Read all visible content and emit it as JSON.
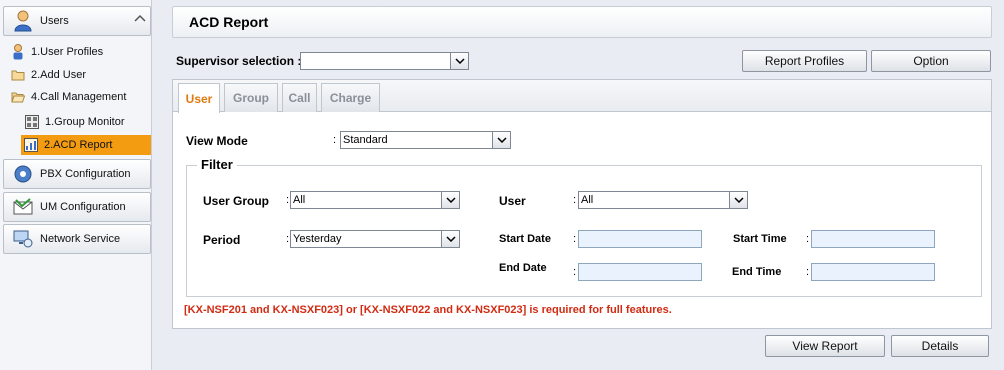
{
  "sidebar": {
    "users": {
      "label": "Users"
    },
    "user_items": [
      {
        "label": "1.User Profiles",
        "icon": "user-profile-icon"
      },
      {
        "label": "2.Add User",
        "icon": "folder-icon"
      },
      {
        "label": "4.Call Management",
        "icon": "folder-open-icon"
      }
    ],
    "call_mgmt_items": [
      {
        "label": "1.Group Monitor",
        "icon": "grid-icon"
      },
      {
        "label": "2.ACD Report",
        "icon": "report-icon",
        "active": true
      }
    ],
    "sections": [
      {
        "label": "PBX Configuration",
        "icon": "pbx-icon"
      },
      {
        "label": "UM Configuration",
        "icon": "um-icon"
      },
      {
        "label": "Network Service",
        "icon": "network-icon"
      }
    ]
  },
  "page": {
    "title": "ACD Report",
    "supervisor_label": "Supervisor selection :",
    "supervisor_value": "",
    "report_profiles_btn": "Report Profiles",
    "option_btn": "Option",
    "tabs": [
      "User",
      "Group",
      "Call",
      "Charge"
    ],
    "active_tab": "User",
    "view_mode_label": "View Mode",
    "view_mode_value": "Standard",
    "filter_title": "Filter",
    "user_group_label": "User Group",
    "user_group_value": "All",
    "user_label": "User",
    "user_value": "All",
    "period_label": "Period",
    "period_value": "Yesterday",
    "start_date_label": "Start Date",
    "start_date_value": "",
    "start_time_label": "Start Time",
    "start_time_value": "",
    "end_date_label": "End Date",
    "end_date_value": "",
    "end_time_label": "End Time",
    "end_time_value": "",
    "colon": ":",
    "warning": "[KX-NSF201 and KX-NSXF023] or [KX-NSXF022 and KX-NSXF023] is required for full features.",
    "view_report_btn": "View Report",
    "details_btn": "Details"
  },
  "colors": {
    "accent": "#f39c12",
    "warning": "#d12b12",
    "active_tab": "#e07a10"
  }
}
